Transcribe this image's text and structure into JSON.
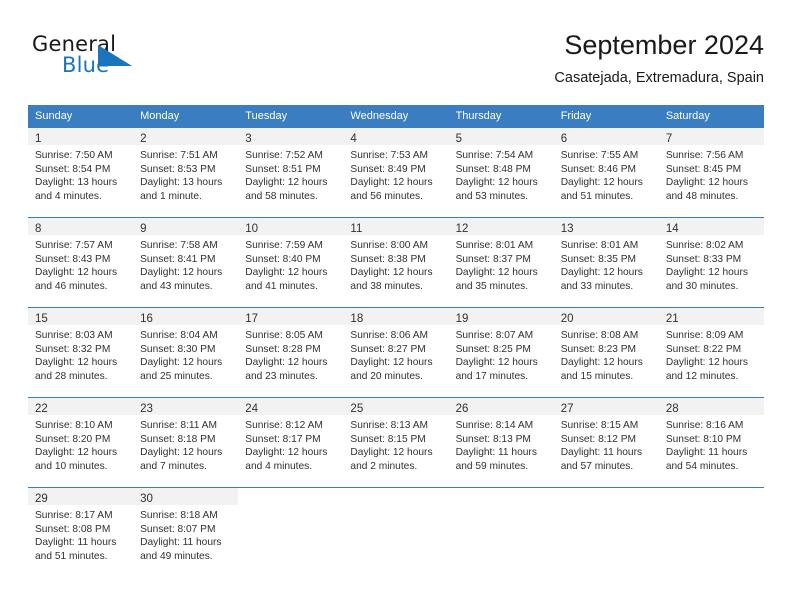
{
  "logo": {
    "word_one": "General",
    "word_two": "Blue",
    "triangle_color": "#1b75bc"
  },
  "header": {
    "month_title": "September 2024",
    "location": "Casatejada, Extremadura, Spain"
  },
  "theme": {
    "header_band": "#3a7dc1",
    "daynum_band": "#f2f2f2",
    "text": "#33312f"
  },
  "calendar": {
    "weekday_headers": [
      "Sunday",
      "Monday",
      "Tuesday",
      "Wednesday",
      "Thursday",
      "Friday",
      "Saturday"
    ],
    "weeks": [
      [
        {
          "day": "1",
          "sunrise": "Sunrise: 7:50 AM",
          "sunset": "Sunset: 8:54 PM",
          "daylight_1": "Daylight: 13 hours",
          "daylight_2": "and 4 minutes."
        },
        {
          "day": "2",
          "sunrise": "Sunrise: 7:51 AM",
          "sunset": "Sunset: 8:53 PM",
          "daylight_1": "Daylight: 13 hours",
          "daylight_2": "and 1 minute."
        },
        {
          "day": "3",
          "sunrise": "Sunrise: 7:52 AM",
          "sunset": "Sunset: 8:51 PM",
          "daylight_1": "Daylight: 12 hours",
          "daylight_2": "and 58 minutes."
        },
        {
          "day": "4",
          "sunrise": "Sunrise: 7:53 AM",
          "sunset": "Sunset: 8:49 PM",
          "daylight_1": "Daylight: 12 hours",
          "daylight_2": "and 56 minutes."
        },
        {
          "day": "5",
          "sunrise": "Sunrise: 7:54 AM",
          "sunset": "Sunset: 8:48 PM",
          "daylight_1": "Daylight: 12 hours",
          "daylight_2": "and 53 minutes."
        },
        {
          "day": "6",
          "sunrise": "Sunrise: 7:55 AM",
          "sunset": "Sunset: 8:46 PM",
          "daylight_1": "Daylight: 12 hours",
          "daylight_2": "and 51 minutes."
        },
        {
          "day": "7",
          "sunrise": "Sunrise: 7:56 AM",
          "sunset": "Sunset: 8:45 PM",
          "daylight_1": "Daylight: 12 hours",
          "daylight_2": "and 48 minutes."
        }
      ],
      [
        {
          "day": "8",
          "sunrise": "Sunrise: 7:57 AM",
          "sunset": "Sunset: 8:43 PM",
          "daylight_1": "Daylight: 12 hours",
          "daylight_2": "and 46 minutes."
        },
        {
          "day": "9",
          "sunrise": "Sunrise: 7:58 AM",
          "sunset": "Sunset: 8:41 PM",
          "daylight_1": "Daylight: 12 hours",
          "daylight_2": "and 43 minutes."
        },
        {
          "day": "10",
          "sunrise": "Sunrise: 7:59 AM",
          "sunset": "Sunset: 8:40 PM",
          "daylight_1": "Daylight: 12 hours",
          "daylight_2": "and 41 minutes."
        },
        {
          "day": "11",
          "sunrise": "Sunrise: 8:00 AM",
          "sunset": "Sunset: 8:38 PM",
          "daylight_1": "Daylight: 12 hours",
          "daylight_2": "and 38 minutes."
        },
        {
          "day": "12",
          "sunrise": "Sunrise: 8:01 AM",
          "sunset": "Sunset: 8:37 PM",
          "daylight_1": "Daylight: 12 hours",
          "daylight_2": "and 35 minutes."
        },
        {
          "day": "13",
          "sunrise": "Sunrise: 8:01 AM",
          "sunset": "Sunset: 8:35 PM",
          "daylight_1": "Daylight: 12 hours",
          "daylight_2": "and 33 minutes."
        },
        {
          "day": "14",
          "sunrise": "Sunrise: 8:02 AM",
          "sunset": "Sunset: 8:33 PM",
          "daylight_1": "Daylight: 12 hours",
          "daylight_2": "and 30 minutes."
        }
      ],
      [
        {
          "day": "15",
          "sunrise": "Sunrise: 8:03 AM",
          "sunset": "Sunset: 8:32 PM",
          "daylight_1": "Daylight: 12 hours",
          "daylight_2": "and 28 minutes."
        },
        {
          "day": "16",
          "sunrise": "Sunrise: 8:04 AM",
          "sunset": "Sunset: 8:30 PM",
          "daylight_1": "Daylight: 12 hours",
          "daylight_2": "and 25 minutes."
        },
        {
          "day": "17",
          "sunrise": "Sunrise: 8:05 AM",
          "sunset": "Sunset: 8:28 PM",
          "daylight_1": "Daylight: 12 hours",
          "daylight_2": "and 23 minutes."
        },
        {
          "day": "18",
          "sunrise": "Sunrise: 8:06 AM",
          "sunset": "Sunset: 8:27 PM",
          "daylight_1": "Daylight: 12 hours",
          "daylight_2": "and 20 minutes."
        },
        {
          "day": "19",
          "sunrise": "Sunrise: 8:07 AM",
          "sunset": "Sunset: 8:25 PM",
          "daylight_1": "Daylight: 12 hours",
          "daylight_2": "and 17 minutes."
        },
        {
          "day": "20",
          "sunrise": "Sunrise: 8:08 AM",
          "sunset": "Sunset: 8:23 PM",
          "daylight_1": "Daylight: 12 hours",
          "daylight_2": "and 15 minutes."
        },
        {
          "day": "21",
          "sunrise": "Sunrise: 8:09 AM",
          "sunset": "Sunset: 8:22 PM",
          "daylight_1": "Daylight: 12 hours",
          "daylight_2": "and 12 minutes."
        }
      ],
      [
        {
          "day": "22",
          "sunrise": "Sunrise: 8:10 AM",
          "sunset": "Sunset: 8:20 PM",
          "daylight_1": "Daylight: 12 hours",
          "daylight_2": "and 10 minutes."
        },
        {
          "day": "23",
          "sunrise": "Sunrise: 8:11 AM",
          "sunset": "Sunset: 8:18 PM",
          "daylight_1": "Daylight: 12 hours",
          "daylight_2": "and 7 minutes."
        },
        {
          "day": "24",
          "sunrise": "Sunrise: 8:12 AM",
          "sunset": "Sunset: 8:17 PM",
          "daylight_1": "Daylight: 12 hours",
          "daylight_2": "and 4 minutes."
        },
        {
          "day": "25",
          "sunrise": "Sunrise: 8:13 AM",
          "sunset": "Sunset: 8:15 PM",
          "daylight_1": "Daylight: 12 hours",
          "daylight_2": "and 2 minutes."
        },
        {
          "day": "26",
          "sunrise": "Sunrise: 8:14 AM",
          "sunset": "Sunset: 8:13 PM",
          "daylight_1": "Daylight: 11 hours",
          "daylight_2": "and 59 minutes."
        },
        {
          "day": "27",
          "sunrise": "Sunrise: 8:15 AM",
          "sunset": "Sunset: 8:12 PM",
          "daylight_1": "Daylight: 11 hours",
          "daylight_2": "and 57 minutes."
        },
        {
          "day": "28",
          "sunrise": "Sunrise: 8:16 AM",
          "sunset": "Sunset: 8:10 PM",
          "daylight_1": "Daylight: 11 hours",
          "daylight_2": "and 54 minutes."
        }
      ],
      [
        {
          "day": "29",
          "sunrise": "Sunrise: 8:17 AM",
          "sunset": "Sunset: 8:08 PM",
          "daylight_1": "Daylight: 11 hours",
          "daylight_2": "and 51 minutes."
        },
        {
          "day": "30",
          "sunrise": "Sunrise: 8:18 AM",
          "sunset": "Sunset: 8:07 PM",
          "daylight_1": "Daylight: 11 hours",
          "daylight_2": "and 49 minutes."
        },
        null,
        null,
        null,
        null,
        null
      ]
    ]
  }
}
